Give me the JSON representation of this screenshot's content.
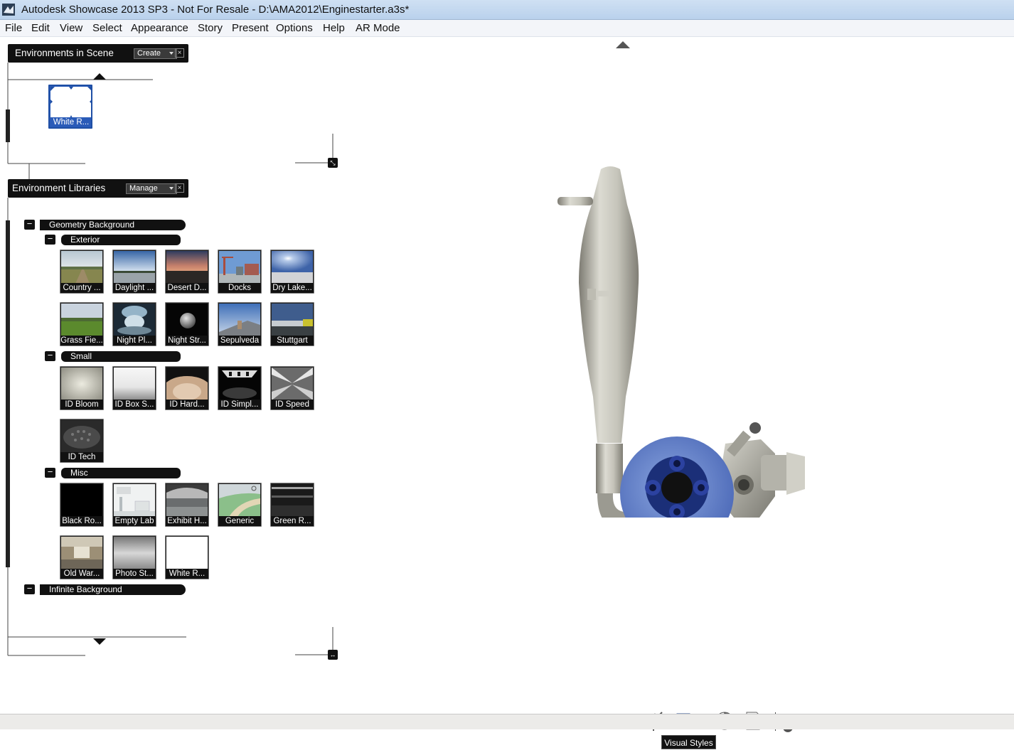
{
  "window": {
    "title": "Autodesk Showcase 2013 SP3 - Not For Resale - D:\\AMA2012\\Enginestarter.a3s*"
  },
  "menu": [
    "File",
    "Edit",
    "View",
    "Select",
    "Appearance",
    "Story",
    "Present",
    "Options",
    "Help",
    "AR Mode"
  ],
  "environments_in_scene": {
    "title": "Environments in Scene",
    "dropdown": "Create",
    "close": "×",
    "items": [
      {
        "label": "White R..."
      }
    ]
  },
  "environment_libraries": {
    "title": "Environment Libraries",
    "dropdown": "Manage",
    "close": "×",
    "groups": [
      {
        "label": "Geometry Background",
        "toggle": "−"
      },
      {
        "label": "Infinite Background",
        "toggle": "−"
      }
    ],
    "subgroups": [
      {
        "label": "Exterior",
        "toggle": "−"
      },
      {
        "label": "Small",
        "toggle": "−"
      },
      {
        "label": "Misc",
        "toggle": "−"
      }
    ],
    "exterior": [
      "Country ...",
      "Daylight ...",
      "Desert D...",
      "Docks",
      "Dry Lake...",
      "Grass Fie...",
      "Night Pl...",
      "Night Str...",
      "Sepulveda",
      "Stuttgart"
    ],
    "small": [
      "ID Bloom",
      "ID Box S...",
      "ID Hard...",
      "ID Simpl...",
      "ID Speed",
      "ID Tech"
    ],
    "misc": [
      "Black Ro...",
      "Empty Lab",
      "Exhibit H...",
      "Generic",
      "Green R...",
      "Old War...",
      "Photo St...",
      "White R..."
    ]
  },
  "toolbar": {
    "tools": [
      "folder-icon",
      "dome-icon",
      "light-icon",
      "visual-styles-icon",
      "sphere-half-icon",
      "export-icon"
    ],
    "tooltip": "Visual Styles"
  }
}
